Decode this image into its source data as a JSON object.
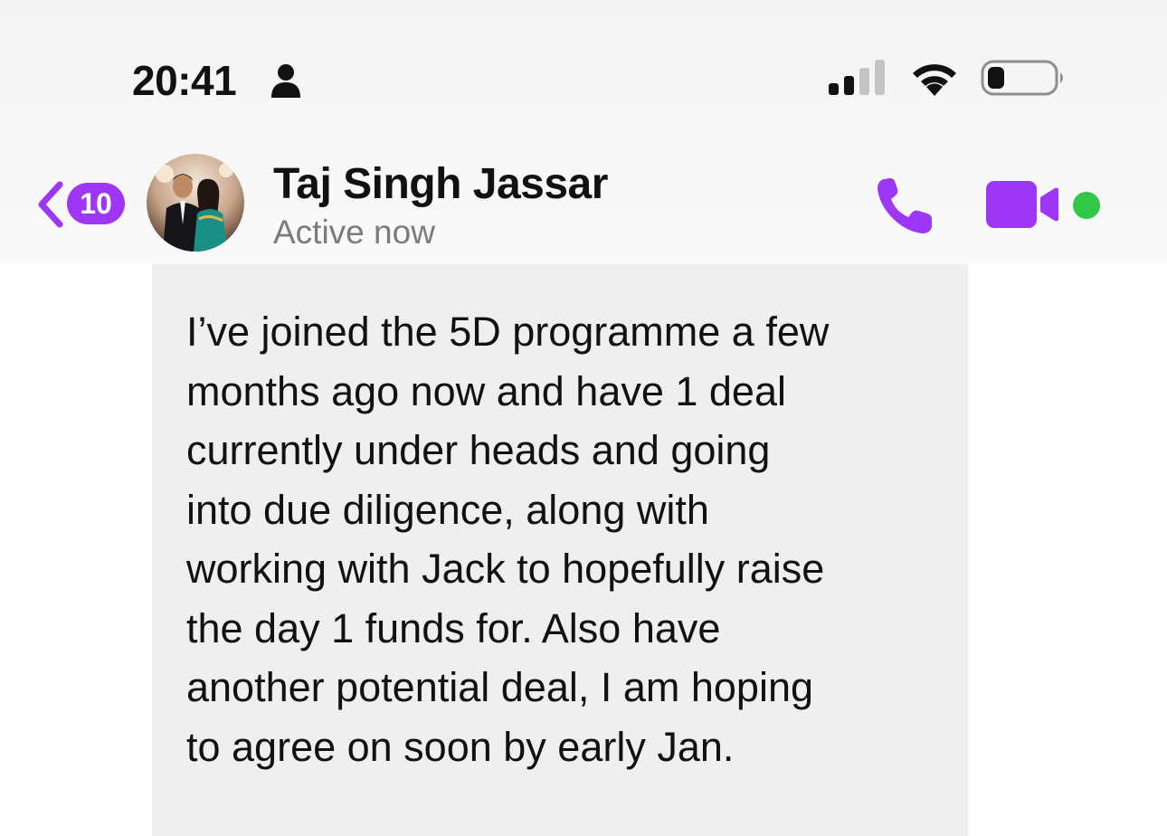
{
  "status_bar": {
    "time": "20:41",
    "icons": [
      "person-icon",
      "cellular-signal-icon",
      "wifi-icon",
      "battery-icon"
    ]
  },
  "header": {
    "back_badge_count": "10",
    "contact_name": "Taj Singh Jassar",
    "contact_status": "Active now",
    "actions": [
      "phone-call-icon",
      "video-call-icon"
    ],
    "online": true
  },
  "colors": {
    "accent": "#9d36f5",
    "online": "#31c84a",
    "bubble": "#efefef",
    "text": "#111111",
    "secondary_text": "#7b7b7f"
  },
  "message": {
    "text": "I’ve joined the 5D programme a few\nmonths ago now and have 1 deal\ncurrently under heads and going\ninto due diligence, along with\nworking with Jack to hopefully raise\nthe day 1 funds for.  Also have\nanother potential deal, I am hoping\nto agree on soon by early Jan."
  }
}
